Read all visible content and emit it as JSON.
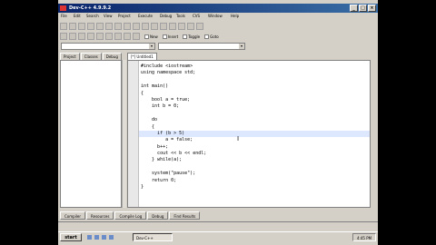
{
  "window": {
    "title": "Dev-C++ 4.9.9.2"
  },
  "menu": [
    "File",
    "Edit",
    "Search",
    "View",
    "Project",
    "Execute",
    "Debug",
    "Tools",
    "CVS",
    "Window",
    "Help"
  ],
  "toolbar": {
    "check_new": "New",
    "check_insert": "Insert",
    "check_toggle": "Toggle",
    "check_goto": "Goto"
  },
  "left_tabs": [
    "Project",
    "Classes",
    "Debug"
  ],
  "editor": {
    "tab_label": "[*] Untitled1",
    "code_lines": [
      "#include <iostream>",
      "using namespace std;",
      "",
      "int main()",
      "{",
      "    bool a = true;",
      "    int b = 0;",
      "",
      "    do",
      "    {",
      "      if (b > 5)",
      "         a = false;",
      "      b++;",
      "      cout << b << endl;",
      "    } while(a);",
      "",
      "    system(\"pause\");",
      "    return 0;",
      "}"
    ],
    "highlight_line": 10
  },
  "bottom_tabs": [
    "Compiler",
    "Resources",
    "Compile Log",
    "Debug",
    "Find Results"
  ],
  "taskbar": {
    "start": "start",
    "task_item": "Dev-C++",
    "clock": "4:45 PM"
  }
}
